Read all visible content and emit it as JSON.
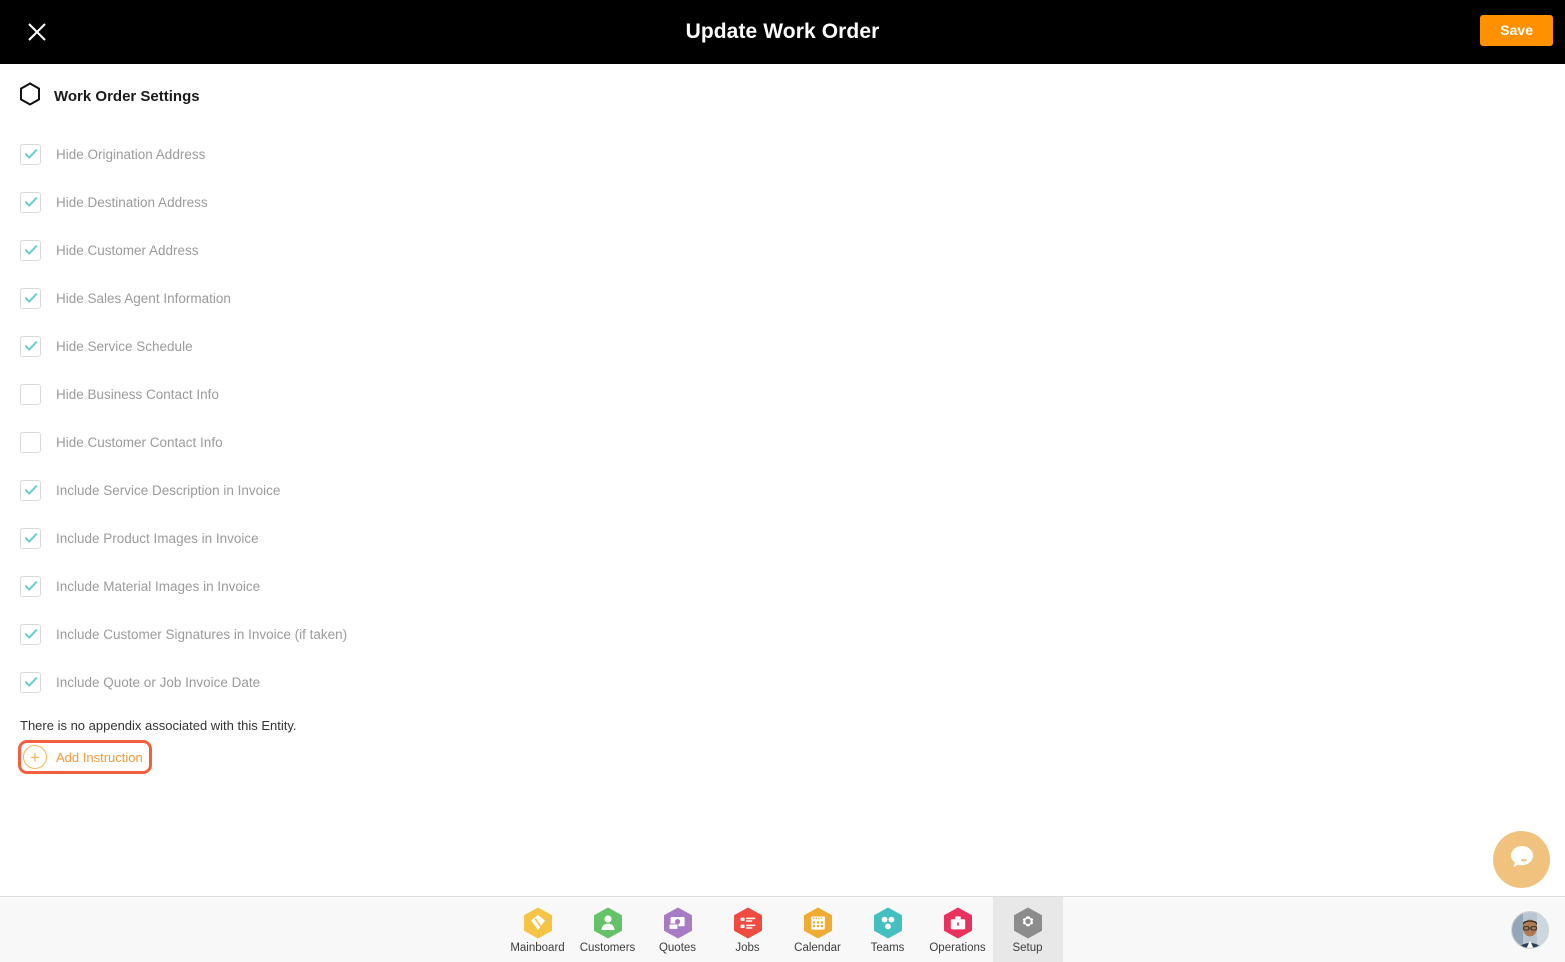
{
  "topbar": {
    "close_icon": "close-icon",
    "title": "Update Work Order",
    "save_label": "Save"
  },
  "section": {
    "icon": "hexagon-icon",
    "title": "Work Order Settings"
  },
  "settings": [
    {
      "label": "Hide Origination Address",
      "checked": true
    },
    {
      "label": "Hide Destination Address",
      "checked": true
    },
    {
      "label": "Hide Customer Address",
      "checked": true
    },
    {
      "label": "Hide Sales Agent Information",
      "checked": true
    },
    {
      "label": "Hide Service Schedule",
      "checked": true
    },
    {
      "label": "Hide Business Contact Info",
      "checked": false
    },
    {
      "label": "Hide Customer Contact Info",
      "checked": false
    },
    {
      "label": "Include Service Description in Invoice",
      "checked": true
    },
    {
      "label": "Include Product Images in Invoice",
      "checked": true
    },
    {
      "label": "Include Material Images in Invoice",
      "checked": true
    },
    {
      "label": "Include Customer Signatures in Invoice (if taken)",
      "checked": true
    },
    {
      "label": "Include Quote or Job Invoice Date",
      "checked": true
    }
  ],
  "appendix": {
    "note": "There is no appendix associated with this Entity.",
    "add_instruction_label": "Add Instruction",
    "plus_icon": "plus-circle-icon"
  },
  "chat": {
    "icon": "chat-bubble-icon"
  },
  "bottom_nav": {
    "items": [
      {
        "label": "Mainboard",
        "icon": "mainboard-icon",
        "color": "#f6c445",
        "active": false
      },
      {
        "label": "Customers",
        "icon": "person-icon",
        "color": "#63c366",
        "active": false
      },
      {
        "label": "Quotes",
        "icon": "money-icon",
        "color": "#a87cc4",
        "active": false
      },
      {
        "label": "Jobs",
        "icon": "list-icon",
        "color": "#ef4b3f",
        "active": false
      },
      {
        "label": "Calendar",
        "icon": "calendar-icon",
        "color": "#f0ab33",
        "active": false
      },
      {
        "label": "Teams",
        "icon": "teams-dots-icon",
        "color": "#45bfbf",
        "active": false
      },
      {
        "label": "Operations",
        "icon": "briefcase-icon",
        "color": "#e8315e",
        "active": false
      },
      {
        "label": "Setup",
        "icon": "gear-icon",
        "color": "#8c8c8c",
        "active": true
      }
    ],
    "avatar": "user-avatar"
  },
  "colors": {
    "accent_orange": "#ff9100",
    "highlight_ring": "#f4603e",
    "check_teal": "#5ccfcf",
    "topbar_bg": "#000000"
  }
}
